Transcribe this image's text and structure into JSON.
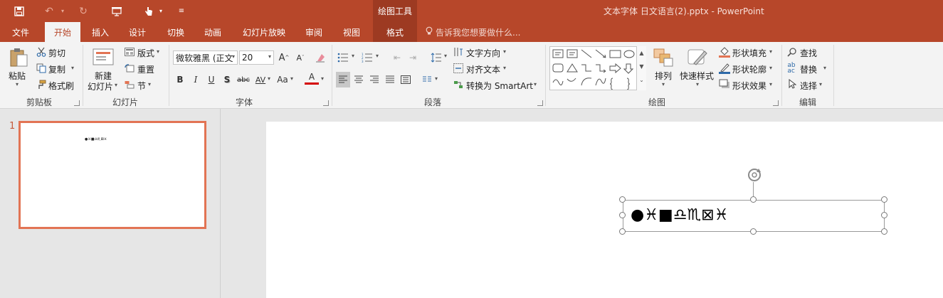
{
  "window": {
    "title": "文本字体 日文语言(2).pptx - PowerPoint",
    "contextual_header": "绘图工具",
    "tell_me_placeholder": "告诉我您想要做什么..."
  },
  "quick_access": {
    "icons": [
      "save-icon",
      "undo-icon",
      "redo-icon",
      "presentation-from-start-icon",
      "touch-mode-icon",
      "customize-qat-icon"
    ]
  },
  "tabs": [
    {
      "label": "文件",
      "active": false
    },
    {
      "label": "开始",
      "active": true
    },
    {
      "label": "插入",
      "active": false
    },
    {
      "label": "设计",
      "active": false
    },
    {
      "label": "切换",
      "active": false
    },
    {
      "label": "动画",
      "active": false
    },
    {
      "label": "幻灯片放映",
      "active": false
    },
    {
      "label": "审阅",
      "active": false
    },
    {
      "label": "视图",
      "active": false
    },
    {
      "label": "格式",
      "active": false,
      "contextual": true
    }
  ],
  "ribbon": {
    "clipboard": {
      "group_label": "剪贴板",
      "paste": "粘贴",
      "cut": "剪切",
      "copy": "复制",
      "format_painter": "格式刷"
    },
    "slides": {
      "group_label": "幻灯片",
      "new_slide_line1": "新建",
      "new_slide_line2": "幻灯片",
      "layout": "版式",
      "reset": "重置",
      "section": "节"
    },
    "font": {
      "group_label": "字体",
      "font_name": "微软雅黑 (正文",
      "font_size": "20",
      "bold": "B",
      "italic": "I",
      "underline": "U",
      "shadow": "S",
      "strikethrough": "abc",
      "char_spacing": "AV",
      "change_case": "Aa",
      "font_color": "A",
      "grow": "A",
      "shrink": "A"
    },
    "paragraph": {
      "group_label": "段落",
      "text_direction": "文字方向",
      "align_text": "对齐文本",
      "convert_smartart": "转换为 SmartArt"
    },
    "drawing": {
      "group_label": "绘图",
      "arrange": "排列",
      "quick_styles": "快速样式",
      "shape_fill": "形状填充",
      "shape_outline": "形状轮廓",
      "shape_effects": "形状效果"
    },
    "editing": {
      "group_label": "编辑",
      "find": "查找",
      "replace": "替换",
      "select": "选择"
    }
  },
  "slide_panel": {
    "slide_number": "1",
    "thumbnail_text": "●♓■♎♏⊠♓"
  },
  "slide": {
    "textbox_text": "●♓■♎♏⊠♓"
  },
  "colors": {
    "brand": "#b7472a",
    "contextual": "#9d3a22",
    "thumb_border": "#e27454"
  }
}
